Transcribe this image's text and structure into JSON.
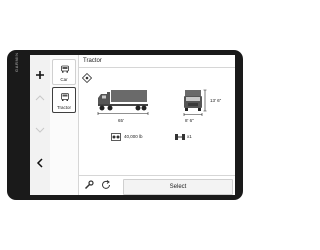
{
  "device": {
    "brand": "GARMIN"
  },
  "sidebar": {
    "vehicles": [
      {
        "label": "Car",
        "icon": "car-icon"
      },
      {
        "label": "Tractor",
        "icon": "truck-icon",
        "selected": true
      }
    ]
  },
  "main": {
    "title": "Tractor",
    "length": "65'",
    "width": "8' 6\"",
    "height": "13' 6\"",
    "weight": "40,000 lb",
    "axles": "x1",
    "select_label": "Select"
  }
}
